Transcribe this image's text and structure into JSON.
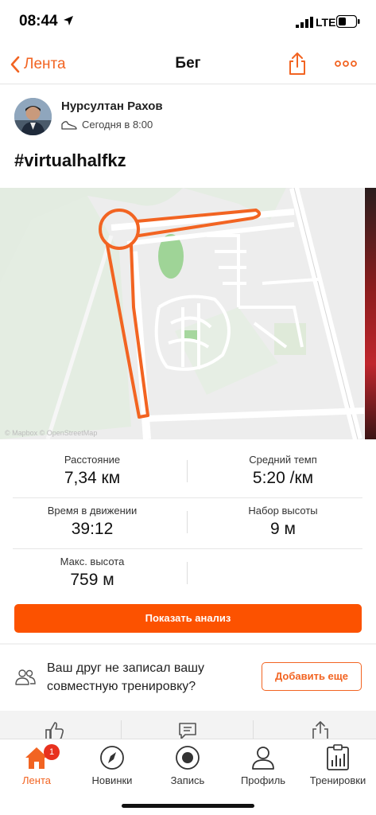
{
  "status_bar": {
    "time": "08:44",
    "network": "LTE",
    "icons": [
      "location-arrow-icon",
      "signal-icon",
      "battery-icon"
    ]
  },
  "nav": {
    "back_label": "Лента",
    "title": "Бег",
    "icons": [
      "chevron-left-icon",
      "share-icon",
      "more-icon"
    ]
  },
  "activity": {
    "athlete_name": "Нурсултан Рахов",
    "time_text": "Сегодня в 8:00",
    "title": "#virtualhalfkz",
    "type_icon": "running-shoe-icon"
  },
  "map": {
    "attribution": "© Mapbox © OpenStreetMap",
    "route_color": "#f26422"
  },
  "stats": {
    "distance_label": "Расстояние",
    "distance_value": "7,34 км",
    "pace_label": "Средний темп",
    "pace_value": "5:20 /км",
    "moving_time_label": "Время в движении",
    "moving_time_value": "39:12",
    "elevation_gain_label": "Набор высоты",
    "elevation_gain_value": "9 м",
    "max_elevation_label": "Макс. высота",
    "max_elevation_value": "759 м"
  },
  "analysis_button": "Показать анализ",
  "friend_prompt": {
    "text": "Ваш друг не записал вашу совместную тренировку?",
    "button": "Добавить еще",
    "icon": "friends-icon"
  },
  "social": {
    "icons": [
      "thumbs-up-icon",
      "comment-icon",
      "share-icon"
    ]
  },
  "tabs": [
    {
      "label": "Лента",
      "icon": "home-icon",
      "badge": "1",
      "active": true
    },
    {
      "label": "Новинки",
      "icon": "compass-icon"
    },
    {
      "label": "Запись",
      "icon": "record-icon"
    },
    {
      "label": "Профиль",
      "icon": "profile-icon"
    },
    {
      "label": "Тренировки",
      "icon": "training-log-icon"
    }
  ],
  "colors": {
    "accent": "#fc5200",
    "accent_text": "#f26422",
    "badge": "#e8311e"
  }
}
